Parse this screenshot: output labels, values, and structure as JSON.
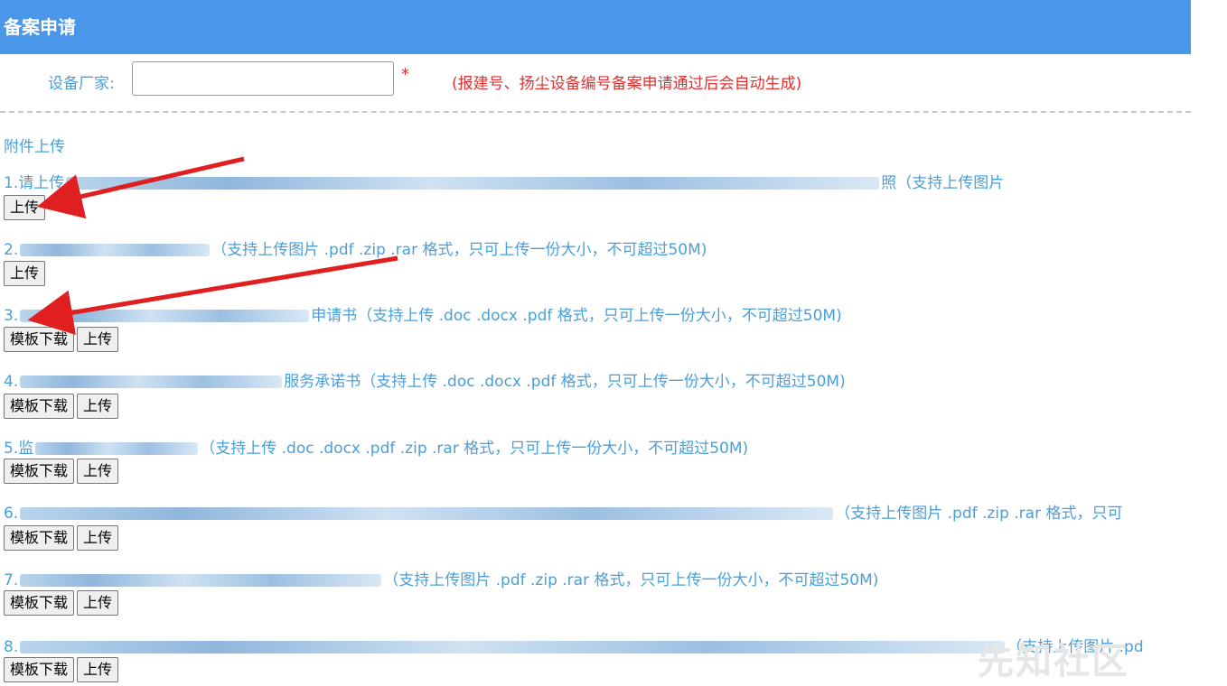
{
  "header": {
    "title": "备案申请"
  },
  "vendor": {
    "label": "设备厂家:",
    "value": "",
    "required_mark": "*",
    "note": "(报建号、扬尘设备编号备案申请通过后会自动生成)"
  },
  "attachments": {
    "title": "附件上传",
    "items": [
      {
        "prefix": "1.请上传",
        "suffix": "照（支持上传图片",
        "buttons": {
          "upload": "上传"
        }
      },
      {
        "prefix": "2.",
        "suffix": "（支持上传图片 .pdf .zip .rar 格式，只可上传一份大小，不可超过50M)",
        "buttons": {
          "upload": "上传"
        }
      },
      {
        "prefix": "3.",
        "suffix": "申请书（支持上传 .doc .docx .pdf 格式，只可上传一份大小，不可超过50M)",
        "buttons": {
          "template": "模板下载",
          "upload": "上传"
        }
      },
      {
        "prefix": "4.",
        "suffix": "服务承诺书（支持上传 .doc .docx .pdf 格式，只可上传一份大小，不可超过50M)",
        "buttons": {
          "template": "模板下载",
          "upload": "上传"
        }
      },
      {
        "prefix": "5.监",
        "suffix": "（支持上传 .doc .docx .pdf .zip .rar 格式，只可上传一份大小，不可超过50M)",
        "buttons": {
          "template": "模板下载",
          "upload": "上传"
        }
      },
      {
        "prefix": "6.",
        "suffix": "（支持上传图片 .pdf .zip .rar 格式，只可",
        "buttons": {
          "template": "模板下载",
          "upload": "上传"
        }
      },
      {
        "prefix": "7.",
        "suffix": "（支持上传图片 .pdf .zip .rar 格式，只可上传一份大小，不可超过50M)",
        "buttons": {
          "template": "模板下载",
          "upload": "上传"
        }
      },
      {
        "prefix": "8.",
        "suffix": "（支持上传图片 .pd",
        "buttons": {
          "template": "模板下载",
          "upload": "上传"
        }
      }
    ]
  },
  "colors": {
    "header_bg": "#4a96e8",
    "link_text": "#4a9fd8",
    "required_red": "#e03030",
    "arrow_red": "#e02020"
  },
  "watermark": "先知社区"
}
